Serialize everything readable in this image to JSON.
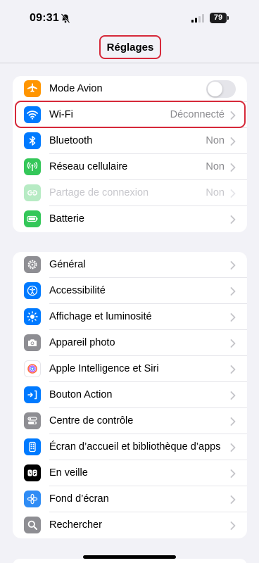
{
  "status_bar": {
    "time": "09:31",
    "battery": "79"
  },
  "header": {
    "title": "Réglages"
  },
  "colors": {
    "accent": "#007aff",
    "highlight": "#d6293a"
  },
  "group1": [
    {
      "label": "Mode Avion",
      "value": "",
      "icon": "airplane-icon",
      "color": "#ff9500"
    },
    {
      "label": "Wi-Fi",
      "value": "Déconnecté",
      "icon": "wifi-icon",
      "color": "#007aff"
    },
    {
      "label": "Bluetooth",
      "value": "Non",
      "icon": "bluetooth-icon",
      "color": "#007aff"
    },
    {
      "label": "Réseau cellulaire",
      "value": "Non",
      "icon": "cellular-icon",
      "color": "#34c759"
    },
    {
      "label": "Partage de connexion",
      "value": "Non",
      "icon": "hotspot-icon",
      "color": "#34c759"
    },
    {
      "label": "Batterie",
      "value": "",
      "icon": "battery-icon",
      "color": "#34c759"
    }
  ],
  "group2": [
    {
      "label": "Général",
      "icon": "gear-icon",
      "color": "#8e8e93"
    },
    {
      "label": "Accessibilité",
      "icon": "accessibility-icon",
      "color": "#007aff"
    },
    {
      "label": "Affichage et luminosité",
      "icon": "brightness-icon",
      "color": "#007aff"
    },
    {
      "label": "Appareil photo",
      "icon": "camera-icon",
      "color": "#8e8e93"
    },
    {
      "label": "Apple Intelligence et Siri",
      "icon": "siri-icon",
      "color": "#ffffff"
    },
    {
      "label": "Bouton Action",
      "icon": "action-button-icon",
      "color": "#007aff"
    },
    {
      "label": "Centre de contrôle",
      "icon": "control-center-icon",
      "color": "#8e8e93"
    },
    {
      "label": "Écran d’accueil et bibliothèque d’apps",
      "icon": "home-screen-icon",
      "color": "#007aff"
    },
    {
      "label": "En veille",
      "icon": "standby-icon",
      "color": "#000000"
    },
    {
      "label": "Fond d’écran",
      "icon": "wallpaper-icon",
      "color": "#007aff"
    },
    {
      "label": "Rechercher",
      "icon": "search-icon",
      "color": "#8e8e93"
    }
  ]
}
